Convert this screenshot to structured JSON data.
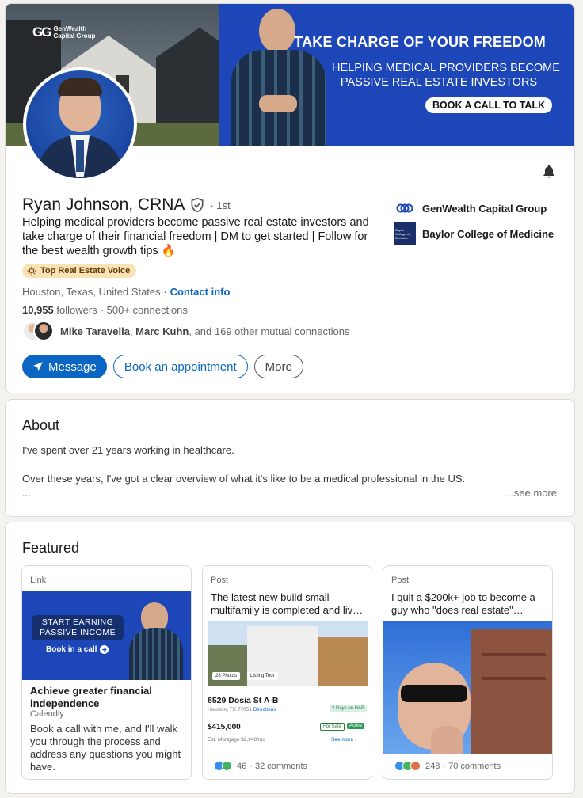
{
  "banner": {
    "logo_mark": "GG",
    "logo_line1": "GenWealth",
    "logo_line2": "Capital Group",
    "title": "TAKE CHARGE OF YOUR FREEDOM",
    "subtitle_line1": "HELPING MEDICAL PROVIDERS BECOME",
    "subtitle_line2": "PASSIVE REAL ESTATE INVESTORS",
    "cta": "BOOK A CALL TO TALK"
  },
  "profile": {
    "name": "Ryan Johnson, CRNA",
    "degree": "· 1st",
    "headline": "Helping medical providers become passive real estate investors and take charge of their financial freedom | DM to get started | Follow for the best wealth growth tips 🔥",
    "badge": "Top Real Estate Voice",
    "location": "Houston, Texas, United States ·",
    "contact_info": "Contact info",
    "followers_count": "10,955",
    "followers_label": "followers",
    "connections": "· 500+ connections",
    "mutual_name1": "Mike Taravella",
    "mutual_sep": ",",
    "mutual_name2": "Marc Kuhn",
    "mutual_rest": ", and 169 other mutual connections"
  },
  "experience": [
    {
      "name": "GenWealth Capital Group"
    },
    {
      "name": "Baylor College of Medicine",
      "logo_text": "Baylor College of Medicine"
    }
  ],
  "actions": {
    "message": "Message",
    "book": "Book an appointment",
    "more": "More"
  },
  "about": {
    "title": "About",
    "line1": "I've spent over 21 years working in healthcare.",
    "line2": "Over these years, I've got a clear overview of what it's like to be a medical professional in the US:",
    "line3": "...",
    "see_more": "…see more"
  },
  "featured": {
    "title": "Featured",
    "items": [
      {
        "type": "Link",
        "image_line1": "START EARNING",
        "image_line2": "PASSIVE INCOME",
        "image_cta": "Book in a call",
        "title": "Achieve greater financial independence",
        "source": "Calendly",
        "desc": "Book a call with me, and I'll walk you through the process and address any questions you might have."
      },
      {
        "type": "Post",
        "title": "The latest new build small multifamily is completed and liv…",
        "photos_tag": "28 Photos",
        "tour_tag": "Listing Tour",
        "address": "8529 Dosia St A-B",
        "city": "Houston, TX 77051",
        "directions": "Directions",
        "days": "2 Days on HAR",
        "price": "$415,000",
        "for_sale": "For Sale",
        "active": "Active",
        "mortgage": "Est. Mortgage $2,948/mo",
        "see_more": "See more ›",
        "reactions": "46",
        "comments": "· 32 comments"
      },
      {
        "type": "Post",
        "title": "I quit a $200k+ job to become a guy who \"does real estate\"…",
        "reactions": "248",
        "comments": "· 70 comments"
      }
    ]
  },
  "colors": {
    "brand_blue": "#0a66c2",
    "banner_blue": "#1d47b8",
    "badge_bg": "#fbe2b6"
  },
  "icons": [
    "bell-icon",
    "verified-shield-icon",
    "send-icon",
    "sun-badge-icon",
    "reaction-like-icon",
    "reaction-celebrate-icon",
    "reaction-love-icon",
    "arrow-right-icon"
  ]
}
